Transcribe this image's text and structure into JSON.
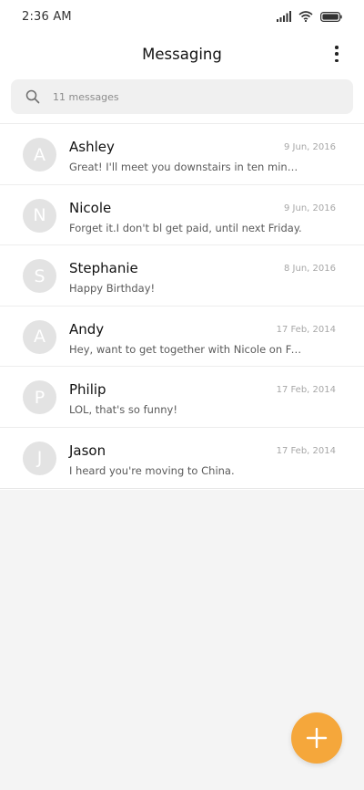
{
  "status_bar": {
    "time": "2:36 AM",
    "icons": [
      "signal-icon",
      "wifi-icon",
      "battery-icon"
    ]
  },
  "app_bar": {
    "title": "Messaging",
    "menu_icon": "more-vertical-icon"
  },
  "search": {
    "icon": "search-icon",
    "placeholder": "11 messages"
  },
  "conversations": [
    {
      "initial": "A",
      "name": "Ashley",
      "date": "9 Jun, 2016",
      "preview": "Great! I'll meet you downstairs in ten minutes. Don..."
    },
    {
      "initial": "N",
      "name": "Nicole",
      "date": "9 Jun, 2016",
      "preview": "Forget it.I don't bl get paid, until next Friday."
    },
    {
      "initial": "S",
      "name": "Stephanie",
      "date": "8 Jun, 2016",
      "preview": "Happy Birthday!"
    },
    {
      "initial": "A",
      "name": "Andy",
      "date": "17 Feb, 2014",
      "preview": "Hey, want to get together with Nicole on Friday?"
    },
    {
      "initial": "P",
      "name": "Philip",
      "date": "17 Feb, 2014",
      "preview": "LOL, that's so funny!"
    },
    {
      "initial": "J",
      "name": "Jason",
      "date": "17 Feb, 2014",
      "preview": "I heard you're moving to China."
    }
  ],
  "fab": {
    "icon": "plus-icon"
  },
  "colors": {
    "accent": "#f5a73b",
    "avatar_bg": "#e3e3e3",
    "background": "#f4f4f4",
    "surface": "#ffffff"
  }
}
